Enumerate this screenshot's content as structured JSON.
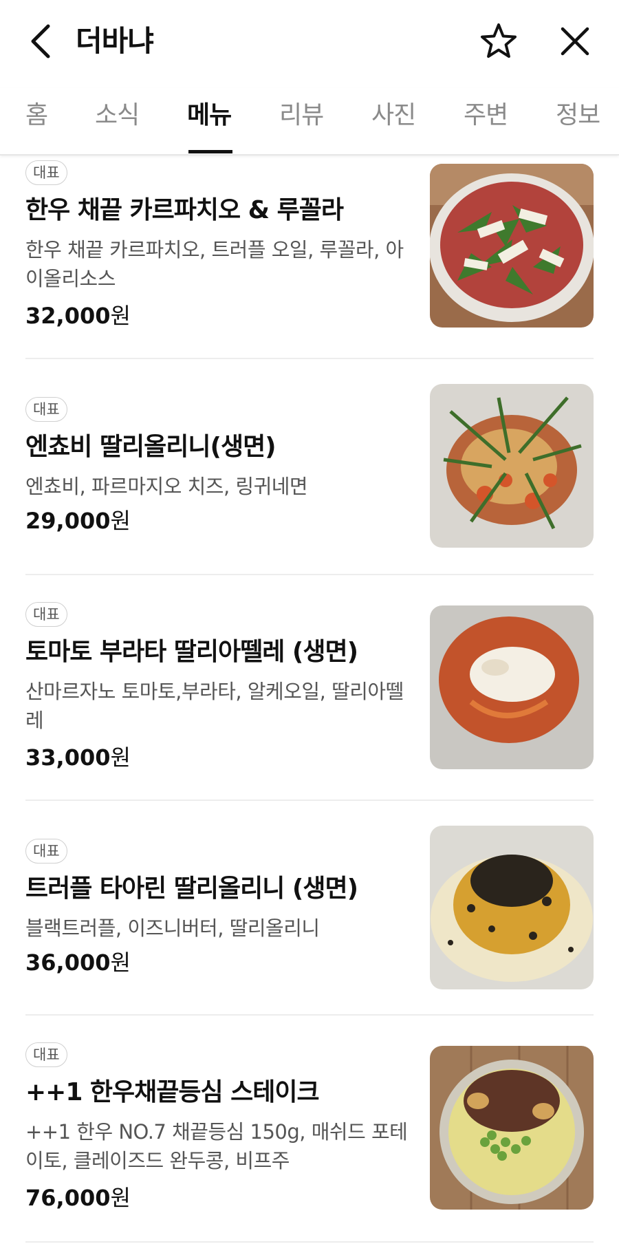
{
  "header": {
    "title": "더바냐"
  },
  "tabs": [
    {
      "label": "홈"
    },
    {
      "label": "소식"
    },
    {
      "label": "메뉴"
    },
    {
      "label": "리뷰"
    },
    {
      "label": "사진"
    },
    {
      "label": "주변"
    },
    {
      "label": "정보"
    }
  ],
  "active_tab": "메뉴",
  "menu": [
    {
      "badge": "대표",
      "name": "한우 채끝 카르파치오 & 루꼴라",
      "desc": "한우 채끝 카르파치오, 트러플 오일, 루꼴라, 아이올리소스",
      "price_num": "32,000",
      "price_unit": "원"
    },
    {
      "badge": "대표",
      "name": "엔쵸비 딸리올리니(생면)",
      "desc": "엔쵸비, 파르마지오 치즈, 링귀네면",
      "price_num": "29,000",
      "price_unit": "원"
    },
    {
      "badge": "대표",
      "name": "토마토 부라타 딸리아뗄레 (생면)",
      "desc": "산마르자노 토마토,부라타, 알케오일, 딸리아뗄레",
      "price_num": "33,000",
      "price_unit": "원"
    },
    {
      "badge": "대표",
      "name": "트러플 타아린 딸리올리니 (생면)",
      "desc": "블랙트러플, 이즈니버터, 딸리올리니",
      "price_num": "36,000",
      "price_unit": "원"
    },
    {
      "badge": "대표",
      "name": "++1 한우채끝등심 스테이크",
      "desc": "++1 한우 NO.7 채끝등심 150g, 매쉬드 포테이토, 클레이즈드 완두콩, 비프주",
      "price_num": "76,000",
      "price_unit": "원"
    }
  ],
  "icons": {
    "back": "chevron-left-icon",
    "favorite": "star-outline-icon",
    "close": "close-icon"
  }
}
